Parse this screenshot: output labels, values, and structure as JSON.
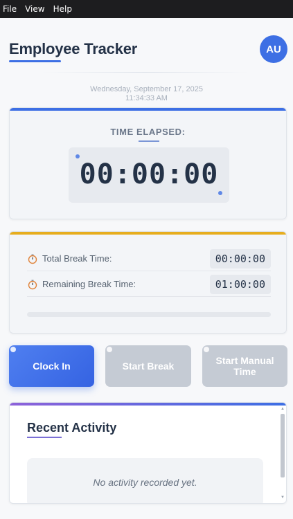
{
  "menu": [
    "File",
    "View",
    "Help"
  ],
  "header": {
    "title": "Employee Tracker",
    "avatar_initials": "AU",
    "date": "Wednesday, September 17, 2025",
    "time": "11:34:33 AM"
  },
  "timer": {
    "label": "TIME ELAPSED:",
    "value": "00:00:00"
  },
  "break": {
    "total_label": "Total Break Time:",
    "total_value": "00:00:00",
    "remaining_label": "Remaining Break Time:",
    "remaining_value": "01:00:00",
    "progress_percent": 0
  },
  "buttons": {
    "clock_in": "Clock In",
    "start_break": "Start Break",
    "start_manual": "Start Manual Time"
  },
  "activity": {
    "title": "Recent Activity",
    "empty_message": "No activity recorded yet."
  },
  "colors": {
    "accent": "#3d6fe4",
    "break_accent": "#e6ad1e",
    "disabled_button": "#c5cbd4"
  },
  "icons": {
    "break_row": "stopwatch-icon"
  }
}
